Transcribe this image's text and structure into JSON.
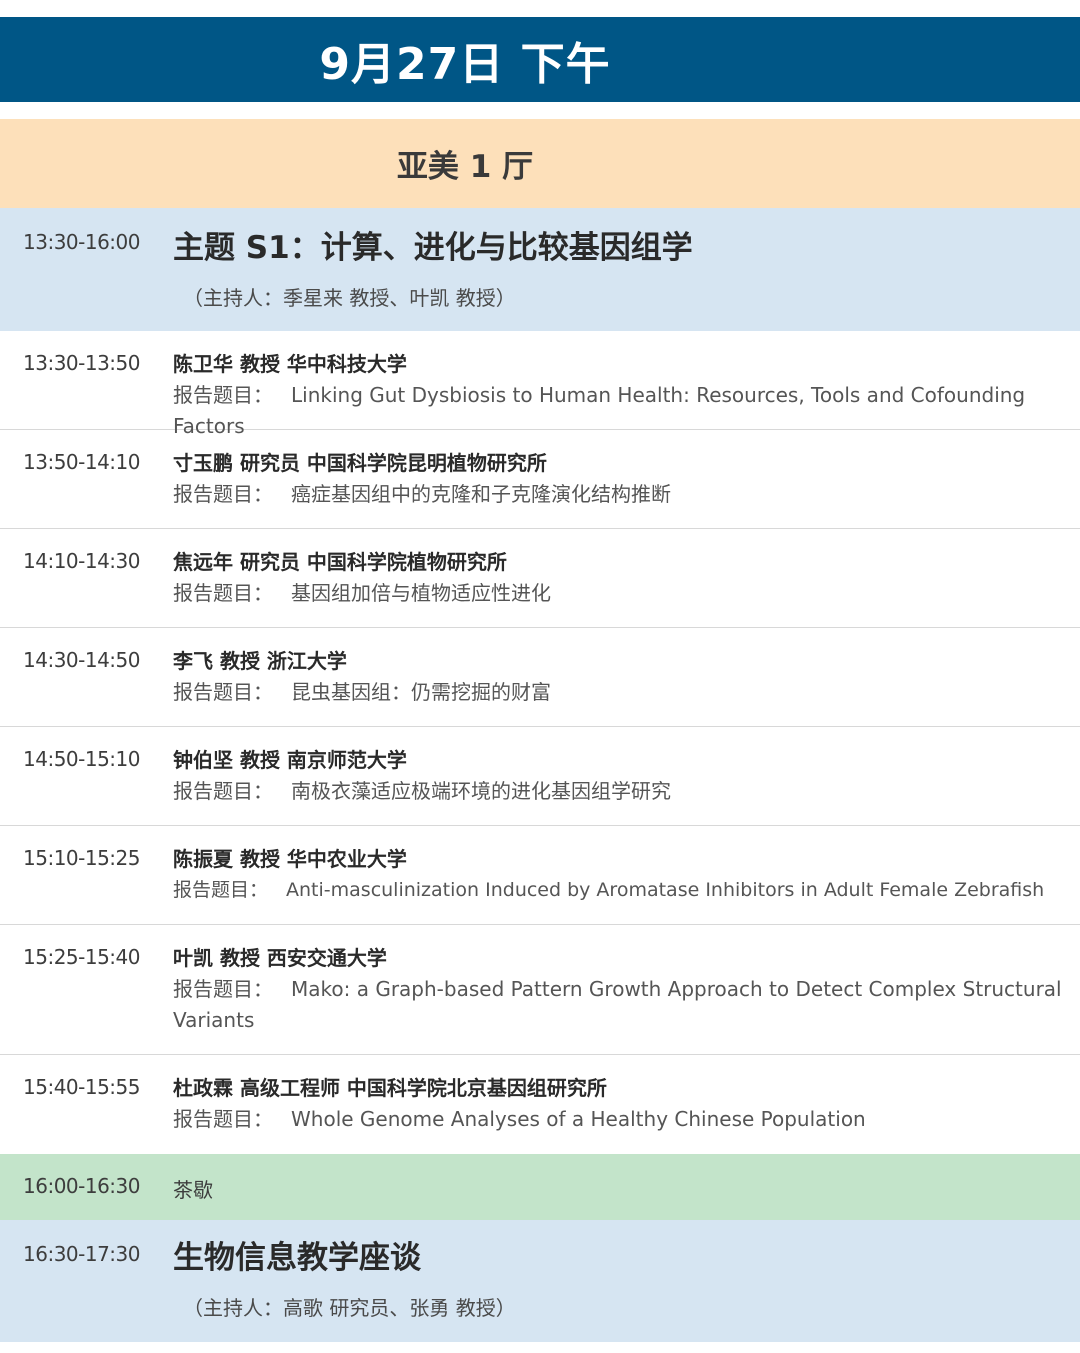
{
  "header": {
    "date_title": "9月27日 下午",
    "hall": "亚美 1 厅"
  },
  "talk_label": "报告题目：",
  "sessions": [
    {
      "time": "13:30-16:00",
      "title": "主题 S1：计算、进化与比较基因组学",
      "host": "（主持人：季星来 教授、叶凯 教授）"
    },
    {
      "time": "16:30-17:30",
      "title": "生物信息教学座谈",
      "host": "（主持人：高歌 研究员、张勇 教授）"
    }
  ],
  "talks": [
    {
      "time": "13:30-13:50",
      "speaker": "陈卫华 教授 华中科技大学",
      "title": "Linking Gut Dysbiosis to Human Health: Resources, Tools and Cofounding Factors"
    },
    {
      "time": "13:50-14:10",
      "speaker": "寸玉鹏 研究员 中国科学院昆明植物研究所",
      "title": "癌症基因组中的克隆和子克隆演化结构推断"
    },
    {
      "time": "14:10-14:30",
      "speaker": "焦远年 研究员 中国科学院植物研究所",
      "title": "基因组加倍与植物适应性进化"
    },
    {
      "time": "14:30-14:50",
      "speaker": "李飞 教授 浙江大学",
      "title": "昆虫基因组：仍需挖掘的财富"
    },
    {
      "time": "14:50-15:10",
      "speaker": "钟伯坚 教授 南京师范大学",
      "title": "南极衣藻适应极端环境的进化基因组学研究"
    },
    {
      "time": "15:10-15:25",
      "speaker": "陈振夏 教授 华中农业大学",
      "title": "Anti-masculinization Induced by Aromatase Inhibitors in Adult Female Zebrafish"
    },
    {
      "time": "15:25-15:40",
      "speaker": "叶凯 教授 西安交通大学",
      "title": "Mako: a Graph-based Pattern Growth Approach to Detect Complex Structural Variants"
    },
    {
      "time": "15:40-15:55",
      "speaker": "杜政霖 高级工程师 中国科学院北京基因组研究所",
      "title": "Whole Genome Analyses of a Healthy Chinese Population"
    }
  ],
  "break": {
    "time": "16:00-16:30",
    "label": "茶歇"
  },
  "colors": {
    "date_banner": "#005686",
    "hall_banner": "#fde0ba",
    "session_bg": "#d6e5f2",
    "break_bg": "#c3e4ca"
  }
}
